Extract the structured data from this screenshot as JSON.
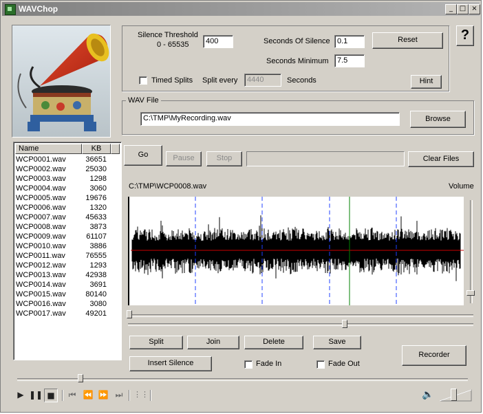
{
  "window": {
    "title": "WAVChop",
    "controls": {
      "minimize": "_",
      "maximize": "□",
      "close": "×"
    }
  },
  "settings": {
    "silence_threshold_label": "Silence Threshold",
    "silence_range_label": "0 - 65535",
    "silence_threshold_value": "400",
    "seconds_of_silence_label": "Seconds Of Silence",
    "seconds_of_silence_value": "0.1",
    "seconds_minimum_label": "Seconds Minimum",
    "seconds_minimum_value": "7.5",
    "reset_label": "Reset",
    "timed_splits_label": "Timed Splits",
    "split_every_label": "Split every",
    "split_every_value": "4440",
    "seconds_label": "Seconds",
    "hint_label": "Hint",
    "help_label": "?"
  },
  "wav_file": {
    "group_label": "WAV File",
    "path": "C:\\TMP\\MyRecording.wav",
    "browse_label": "Browse"
  },
  "file_list": {
    "columns": [
      "Name",
      "KB"
    ],
    "rows": [
      {
        "name": "WCP0001.wav",
        "kb": "36651"
      },
      {
        "name": "WCP0002.wav",
        "kb": "25030"
      },
      {
        "name": "WCP0003.wav",
        "kb": "1298"
      },
      {
        "name": "WCP0004.wav",
        "kb": "3060"
      },
      {
        "name": "WCP0005.wav",
        "kb": "19676"
      },
      {
        "name": "WCP0006.wav",
        "kb": "1320"
      },
      {
        "name": "WCP0007.wav",
        "kb": "45633"
      },
      {
        "name": "WCP0008.wav",
        "kb": "3873"
      },
      {
        "name": "WCP0009.wav",
        "kb": "61107"
      },
      {
        "name": "WCP0010.wav",
        "kb": "3886"
      },
      {
        "name": "WCP0011.wav",
        "kb": "76555"
      },
      {
        "name": "WCP0012.wav",
        "kb": "1293"
      },
      {
        "name": "WCP0013.wav",
        "kb": "42938"
      },
      {
        "name": "WCP0014.wav",
        "kb": "3691"
      },
      {
        "name": "WCP0015.wav",
        "kb": "80140"
      },
      {
        "name": "WCP0016.wav",
        "kb": "3080"
      },
      {
        "name": "WCP0017.wav",
        "kb": "49201"
      }
    ]
  },
  "process": {
    "go_label": "Go",
    "pause_label": "Pause",
    "stop_label": "Stop",
    "clear_files_label": "Clear Files"
  },
  "waveform": {
    "current_file": "C:\\TMP\\WCP0008.wav",
    "volume_label": "Volume",
    "split_markers": [
      0.2,
      0.4,
      0.6,
      0.8
    ],
    "playhead": 0.66
  },
  "edit": {
    "split_label": "Split",
    "join_label": "Join",
    "delete_label": "Delete",
    "save_label": "Save",
    "insert_silence_label": "Insert Silence",
    "fade_in_label": "Fade In",
    "fade_out_label": "Fade Out",
    "recorder_label": "Recorder"
  },
  "colors": {
    "window_bg": "#d4d0c8",
    "wave": "#000000",
    "center_line": "#cc0000",
    "split_marker": "#2040ff",
    "playhead": "#008000"
  },
  "player": {
    "icons": [
      "play-icon",
      "pause-icon",
      "stop-icon",
      "skip-start-icon",
      "rewind-icon",
      "fast-forward-icon",
      "skip-end-icon",
      "playlist-icon",
      "speaker-icon"
    ],
    "position": 0.14
  }
}
